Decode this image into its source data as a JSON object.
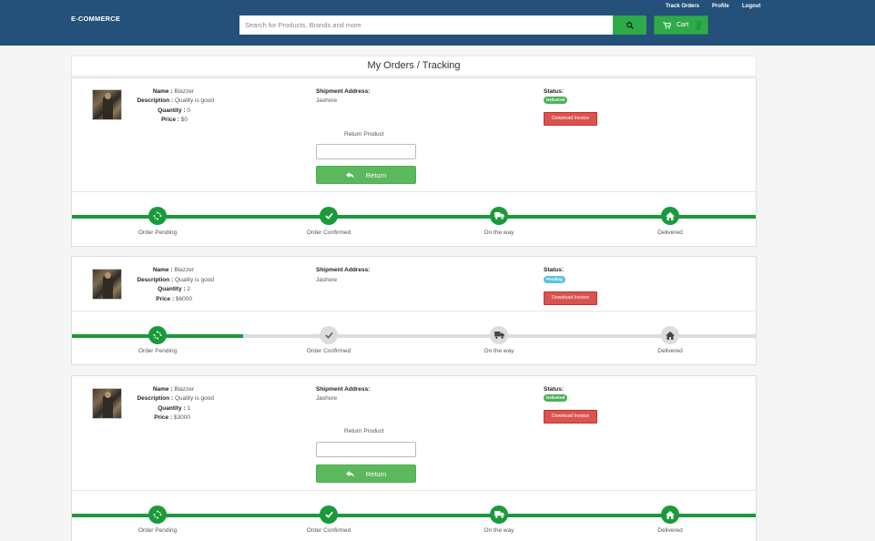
{
  "header": {
    "brand": "E-COMMERCE",
    "search_placeholder": "Search for Products, Brands and more",
    "cart_label": "Cart",
    "links": [
      "Track Orders",
      "Profile",
      "Logout"
    ]
  },
  "page_title": "My Orders / Tracking",
  "labels": {
    "name": "Name :",
    "description": "Description :",
    "quantity": "Quantity :",
    "price": "Price :",
    "shipment_address": "Shipment Address:",
    "status": "Status:",
    "download_invoice": "Download Invoice",
    "return_product": "Return Product",
    "return_button": "Return"
  },
  "steps": [
    "Order Pending",
    "Order Confirmed",
    "On the way",
    "Delivered"
  ],
  "orders": [
    {
      "name": "Blazzer",
      "description": "Quality is good",
      "quantity": "0",
      "price": "$0",
      "address": "Jashore",
      "status": "Delivered",
      "progress_steps": 4
    },
    {
      "name": "Blazzer",
      "description": "Quality is good",
      "quantity": "2",
      "price": "$6000",
      "address": "Jashore",
      "status": "Pending",
      "progress_steps": 1
    },
    {
      "name": "Blazzer",
      "description": "Quality is good",
      "quantity": "1",
      "price": "$3000",
      "address": "Jashore",
      "status": "Delivered",
      "progress_steps": 4
    }
  ],
  "colors": {
    "navbar": "#24507a",
    "accent_green": "#2eaa4a",
    "progress_green": "#1a9a3a",
    "danger": "#d9534f",
    "info": "#5bc0de"
  }
}
